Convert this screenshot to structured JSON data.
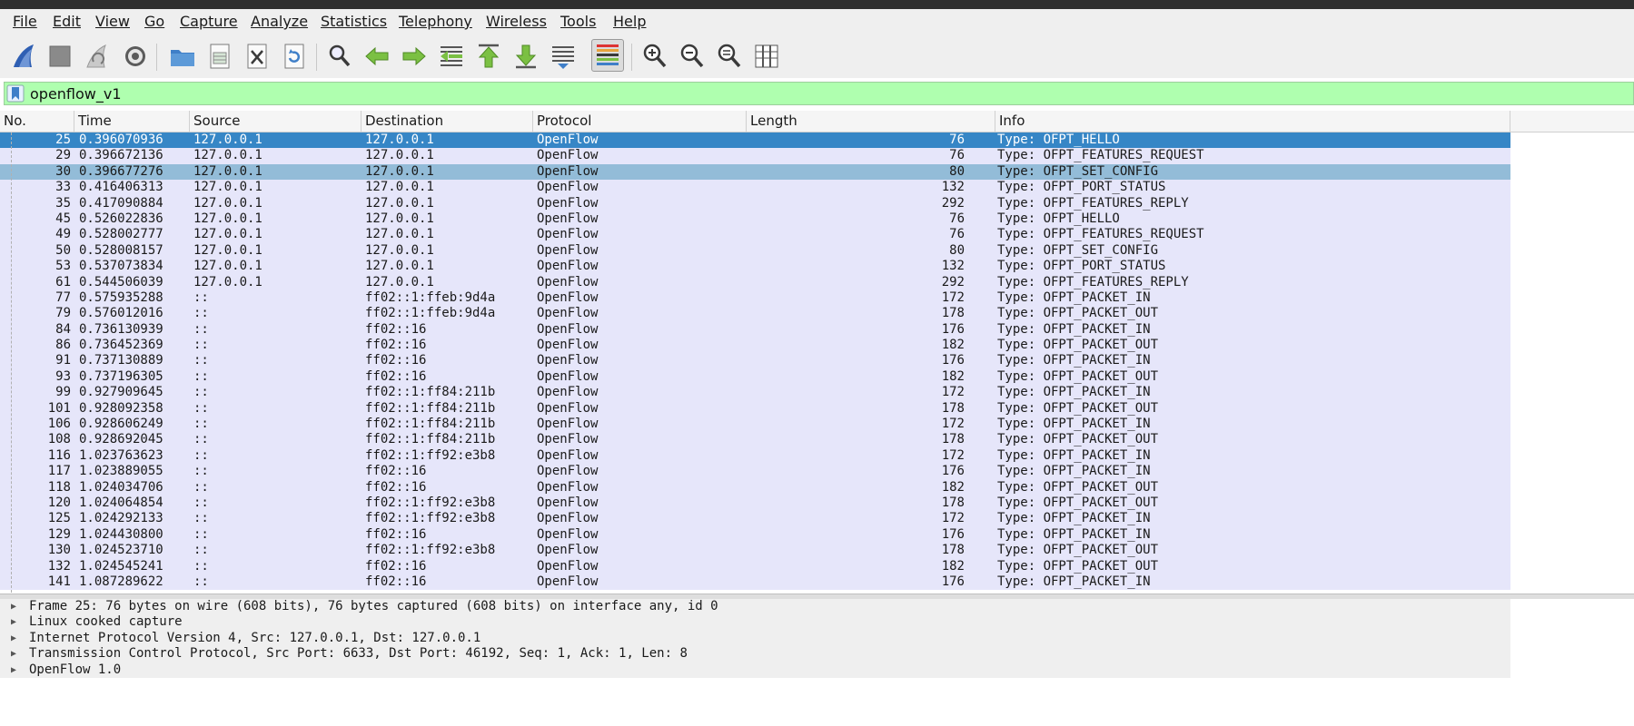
{
  "menu": [
    "File",
    "Edit",
    "View",
    "Go",
    "Capture",
    "Analyze",
    "Statistics",
    "Telephony",
    "Wireless",
    "Tools",
    "Help"
  ],
  "toolbar": {
    "icons": [
      "shark-fin-start-icon",
      "stop-square-icon",
      "restart-fin-icon",
      "gear-options-icon",
      "open-folder-icon",
      "save-file-icon",
      "close-file-icon",
      "reload-file-icon",
      "find-magnifier-icon",
      "go-back-arrow-icon",
      "go-forward-arrow-icon",
      "go-to-packet-icon",
      "first-packet-icon",
      "last-packet-icon",
      "autoscroll-icon",
      "colorize-icon",
      "zoom-in-icon",
      "zoom-out-icon",
      "zoom-normal-icon",
      "resize-columns-icon"
    ]
  },
  "filter": {
    "value": "openflow_v1"
  },
  "columns": [
    "No.",
    "Time",
    "Source",
    "Destination",
    "Protocol",
    "Length",
    "Info"
  ],
  "packets": [
    {
      "no": "25",
      "time": "0.396070936",
      "src": "127.0.0.1",
      "dst": "127.0.0.1",
      "proto": "OpenFlow",
      "len": "76",
      "info": "Type: OFPT_HELLO"
    },
    {
      "no": "29",
      "time": "0.396672136",
      "src": "127.0.0.1",
      "dst": "127.0.0.1",
      "proto": "OpenFlow",
      "len": "76",
      "info": "Type: OFPT_FEATURES_REQUEST"
    },
    {
      "no": "30",
      "time": "0.396677276",
      "src": "127.0.0.1",
      "dst": "127.0.0.1",
      "proto": "OpenFlow",
      "len": "80",
      "info": "Type: OFPT_SET_CONFIG"
    },
    {
      "no": "33",
      "time": "0.416406313",
      "src": "127.0.0.1",
      "dst": "127.0.0.1",
      "proto": "OpenFlow",
      "len": "132",
      "info": "Type: OFPT_PORT_STATUS"
    },
    {
      "no": "35",
      "time": "0.417090884",
      "src": "127.0.0.1",
      "dst": "127.0.0.1",
      "proto": "OpenFlow",
      "len": "292",
      "info": "Type: OFPT_FEATURES_REPLY"
    },
    {
      "no": "45",
      "time": "0.526022836",
      "src": "127.0.0.1",
      "dst": "127.0.0.1",
      "proto": "OpenFlow",
      "len": "76",
      "info": "Type: OFPT_HELLO"
    },
    {
      "no": "49",
      "time": "0.528002777",
      "src": "127.0.0.1",
      "dst": "127.0.0.1",
      "proto": "OpenFlow",
      "len": "76",
      "info": "Type: OFPT_FEATURES_REQUEST"
    },
    {
      "no": "50",
      "time": "0.528008157",
      "src": "127.0.0.1",
      "dst": "127.0.0.1",
      "proto": "OpenFlow",
      "len": "80",
      "info": "Type: OFPT_SET_CONFIG"
    },
    {
      "no": "53",
      "time": "0.537073834",
      "src": "127.0.0.1",
      "dst": "127.0.0.1",
      "proto": "OpenFlow",
      "len": "132",
      "info": "Type: OFPT_PORT_STATUS"
    },
    {
      "no": "61",
      "time": "0.544506039",
      "src": "127.0.0.1",
      "dst": "127.0.0.1",
      "proto": "OpenFlow",
      "len": "292",
      "info": "Type: OFPT_FEATURES_REPLY"
    },
    {
      "no": "77",
      "time": "0.575935288",
      "src": "::",
      "dst": "ff02::1:ffeb:9d4a",
      "proto": "OpenFlow",
      "len": "172",
      "info": "Type: OFPT_PACKET_IN"
    },
    {
      "no": "79",
      "time": "0.576012016",
      "src": "::",
      "dst": "ff02::1:ffeb:9d4a",
      "proto": "OpenFlow",
      "len": "178",
      "info": "Type: OFPT_PACKET_OUT"
    },
    {
      "no": "84",
      "time": "0.736130939",
      "src": "::",
      "dst": "ff02::16",
      "proto": "OpenFlow",
      "len": "176",
      "info": "Type: OFPT_PACKET_IN"
    },
    {
      "no": "86",
      "time": "0.736452369",
      "src": "::",
      "dst": "ff02::16",
      "proto": "OpenFlow",
      "len": "182",
      "info": "Type: OFPT_PACKET_OUT"
    },
    {
      "no": "91",
      "time": "0.737130889",
      "src": "::",
      "dst": "ff02::16",
      "proto": "OpenFlow",
      "len": "176",
      "info": "Type: OFPT_PACKET_IN"
    },
    {
      "no": "93",
      "time": "0.737196305",
      "src": "::",
      "dst": "ff02::16",
      "proto": "OpenFlow",
      "len": "182",
      "info": "Type: OFPT_PACKET_OUT"
    },
    {
      "no": "99",
      "time": "0.927909645",
      "src": "::",
      "dst": "ff02::1:ff84:211b",
      "proto": "OpenFlow",
      "len": "172",
      "info": "Type: OFPT_PACKET_IN"
    },
    {
      "no": "101",
      "time": "0.928092358",
      "src": "::",
      "dst": "ff02::1:ff84:211b",
      "proto": "OpenFlow",
      "len": "178",
      "info": "Type: OFPT_PACKET_OUT"
    },
    {
      "no": "106",
      "time": "0.928606249",
      "src": "::",
      "dst": "ff02::1:ff84:211b",
      "proto": "OpenFlow",
      "len": "172",
      "info": "Type: OFPT_PACKET_IN"
    },
    {
      "no": "108",
      "time": "0.928692045",
      "src": "::",
      "dst": "ff02::1:ff84:211b",
      "proto": "OpenFlow",
      "len": "178",
      "info": "Type: OFPT_PACKET_OUT"
    },
    {
      "no": "116",
      "time": "1.023763623",
      "src": "::",
      "dst": "ff02::1:ff92:e3b8",
      "proto": "OpenFlow",
      "len": "172",
      "info": "Type: OFPT_PACKET_IN"
    },
    {
      "no": "117",
      "time": "1.023889055",
      "src": "::",
      "dst": "ff02::16",
      "proto": "OpenFlow",
      "len": "176",
      "info": "Type: OFPT_PACKET_IN"
    },
    {
      "no": "118",
      "time": "1.024034706",
      "src": "::",
      "dst": "ff02::16",
      "proto": "OpenFlow",
      "len": "182",
      "info": "Type: OFPT_PACKET_OUT"
    },
    {
      "no": "120",
      "time": "1.024064854",
      "src": "::",
      "dst": "ff02::1:ff92:e3b8",
      "proto": "OpenFlow",
      "len": "178",
      "info": "Type: OFPT_PACKET_OUT"
    },
    {
      "no": "125",
      "time": "1.024292133",
      "src": "::",
      "dst": "ff02::1:ff92:e3b8",
      "proto": "OpenFlow",
      "len": "172",
      "info": "Type: OFPT_PACKET_IN"
    },
    {
      "no": "129",
      "time": "1.024430800",
      "src": "::",
      "dst": "ff02::16",
      "proto": "OpenFlow",
      "len": "176",
      "info": "Type: OFPT_PACKET_IN"
    },
    {
      "no": "130",
      "time": "1.024523710",
      "src": "::",
      "dst": "ff02::1:ff92:e3b8",
      "proto": "OpenFlow",
      "len": "178",
      "info": "Type: OFPT_PACKET_OUT"
    },
    {
      "no": "132",
      "time": "1.024545241",
      "src": "::",
      "dst": "ff02::16",
      "proto": "OpenFlow",
      "len": "182",
      "info": "Type: OFPT_PACKET_OUT"
    },
    {
      "no": "141",
      "time": "1.087289622",
      "src": "::",
      "dst": "ff02::16",
      "proto": "OpenFlow",
      "len": "176",
      "info": "Type: OFPT_PACKET_IN"
    }
  ],
  "selected_row": 0,
  "highlighted_row": 2,
  "details": [
    "Frame 25: 76 bytes on wire (608 bits), 76 bytes captured (608 bits) on interface any, id 0",
    "Linux cooked capture",
    "Internet Protocol Version 4, Src: 127.0.0.1, Dst: 127.0.0.1",
    "Transmission Control Protocol, Src Port: 6633, Dst Port: 46192, Seq: 1, Ack: 1, Len: 8",
    "OpenFlow 1.0"
  ],
  "colors": {
    "row_bg": "#e6e6fa",
    "selected_bg": "#3686c6",
    "highlight_bg": "#93bcd8",
    "filter_bg": "#afffaf"
  }
}
